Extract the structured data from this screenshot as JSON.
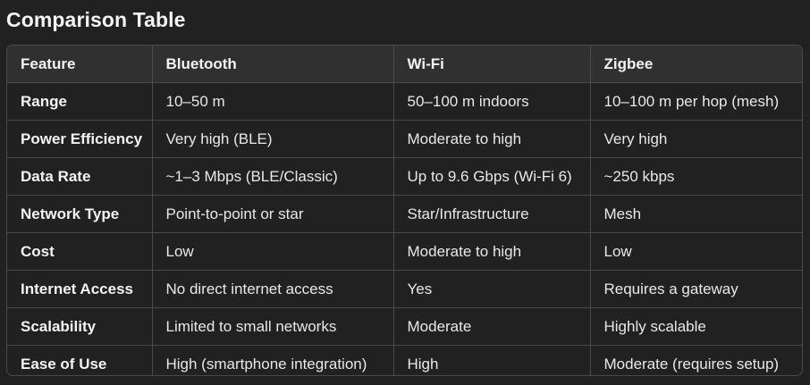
{
  "title": "Comparison Table",
  "table": {
    "headers": [
      "Feature",
      "Bluetooth",
      "Wi-Fi",
      "Zigbee"
    ],
    "rows": [
      [
        "Range",
        "10–50 m",
        "50–100 m indoors",
        "10–100 m per hop (mesh)"
      ],
      [
        "Power Efficiency",
        "Very high (BLE)",
        "Moderate to high",
        "Very high"
      ],
      [
        "Data Rate",
        "~1–3 Mbps (BLE/Classic)",
        "Up to 9.6 Gbps (Wi-Fi 6)",
        "~250 kbps"
      ],
      [
        "Network Type",
        "Point-to-point or star",
        "Star/Infrastructure",
        "Mesh"
      ],
      [
        "Cost",
        "Low",
        "Moderate to high",
        "Low"
      ],
      [
        "Internet Access",
        "No direct internet access",
        "Yes",
        "Requires a gateway"
      ],
      [
        "Scalability",
        "Limited to small networks",
        "Moderate",
        "Highly scalable"
      ],
      [
        "Ease of Use",
        "High (smartphone integration)",
        "High",
        "Moderate (requires setup)"
      ]
    ]
  },
  "colors": {
    "background": "#212121",
    "header_row": "#303030",
    "border": "#4a4a4a",
    "text": "#ececec"
  }
}
